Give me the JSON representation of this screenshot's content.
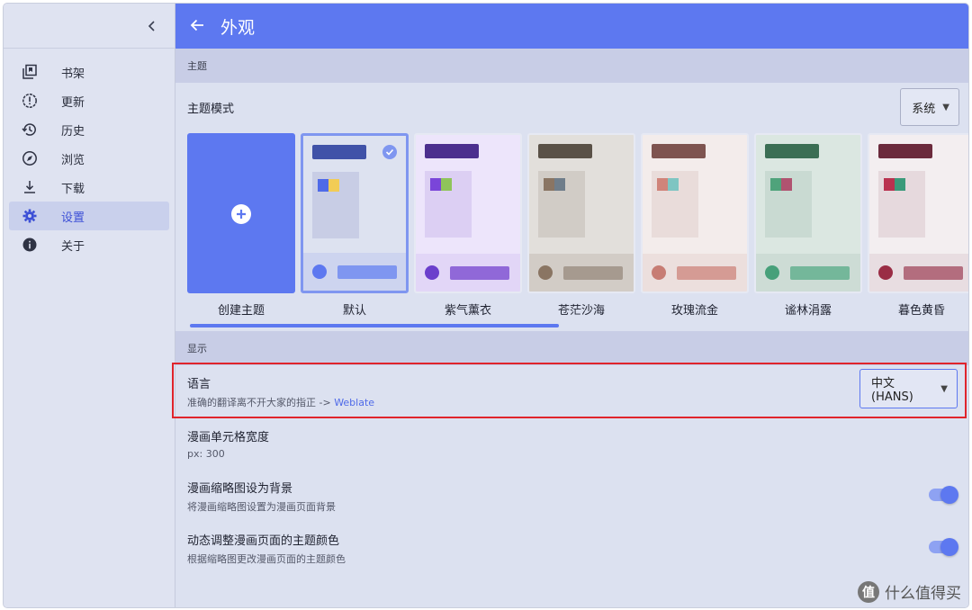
{
  "sidebar": {
    "collapse_icon": "chevron-left-icon",
    "items": [
      {
        "label": "书架",
        "icon": "library-icon"
      },
      {
        "label": "更新",
        "icon": "alert-circle-icon"
      },
      {
        "label": "历史",
        "icon": "history-icon"
      },
      {
        "label": "浏览",
        "icon": "compass-icon"
      },
      {
        "label": "下载",
        "icon": "download-icon"
      },
      {
        "label": "设置",
        "icon": "gear-icon"
      },
      {
        "label": "关于",
        "icon": "info-icon"
      }
    ],
    "active_index": 5
  },
  "appbar": {
    "title": "外观",
    "back_icon": "arrow-left-icon",
    "color": "#5d78f0"
  },
  "theme_section": {
    "header": "主题",
    "mode_label": "主题模式",
    "mode_value": "系统",
    "create_label": "创建主题",
    "themes": [
      {
        "name": "默认",
        "selected": true,
        "bg": "#dde2f0",
        "bar": "#4052a8",
        "panel": "#c8cde5",
        "chipA": "#4f6ae8",
        "chipB": "#f2cc55",
        "bottom": "#cdd4ef",
        "dot": "#5d78f0",
        "pill": "#7f96f0"
      },
      {
        "name": "紫气薰衣",
        "selected": false,
        "bg": "#ede5fb",
        "bar": "#4c2f8e",
        "panel": "#dccff3",
        "chipA": "#7a45d9",
        "chipB": "#8fc45a",
        "bottom": "#e2d6f7",
        "dot": "#6b3fcc",
        "pill": "#9068d8"
      },
      {
        "name": "苍茫沙海",
        "selected": false,
        "bg": "#e2dfdb",
        "bar": "#5a5147",
        "panel": "#d1ccc6",
        "chipA": "#8a7563",
        "chipB": "#6f7d8a",
        "bottom": "#d2ccc6",
        "dot": "#8a7563",
        "pill": "#a69a8f"
      },
      {
        "name": "玫瑰流金",
        "selected": false,
        "bg": "#f3eceb",
        "bar": "#7e5450",
        "panel": "#e9dcda",
        "chipA": "#d0847a",
        "chipB": "#7ec5c2",
        "bottom": "#ecdfdd",
        "dot": "#c77d74",
        "pill": "#d59b94"
      },
      {
        "name": "谧林涓露",
        "selected": false,
        "bg": "#dbe7e1",
        "bar": "#3b6e54",
        "panel": "#c9dad2",
        "chipA": "#4fa37b",
        "chipB": "#b05370",
        "bottom": "#cddcd5",
        "dot": "#47a07a",
        "pill": "#74b79a"
      },
      {
        "name": "暮色黄昏",
        "selected": false,
        "bg": "#f3eef0",
        "bar": "#6b2a3c",
        "panel": "#e6d9dd",
        "chipA": "#b9324f",
        "chipB": "#3a9a7a",
        "bottom": "#e8dde1",
        "dot": "#9a2d45",
        "pill": "#b36d7e"
      }
    ]
  },
  "display_section": {
    "header": "显示",
    "language": {
      "title": "语言",
      "subtitle_prefix": "准确的翻译离不开大家的指正 -> ",
      "subtitle_link": "Weblate",
      "value": "中文 (HANS)"
    },
    "cell_width": {
      "title": "漫画单元格宽度",
      "subtitle": "px: 300"
    },
    "thumb_bg": {
      "title": "漫画缩略图设为背景",
      "subtitle": "将漫画缩略图设置为漫画页面背景",
      "enabled": true
    },
    "dynamic_color": {
      "title": "动态调整漫画页面的主题颜色",
      "subtitle": "根据缩略图更改漫画页面的主题颜色",
      "enabled": true
    }
  },
  "watermark": {
    "badge": "值",
    "text": "什么值得买"
  }
}
